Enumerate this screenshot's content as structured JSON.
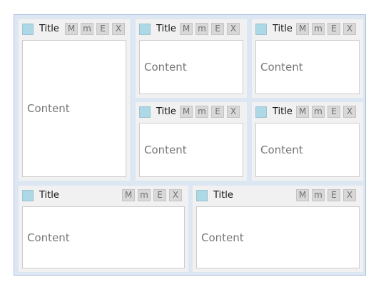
{
  "panels": [
    {
      "title": "Title",
      "buttons": [
        "M",
        "m",
        "E",
        "X"
      ],
      "content": "Content"
    },
    {
      "title": "Title",
      "buttons": [
        "M",
        "m",
        "E",
        "X"
      ],
      "content": "Content"
    },
    {
      "title": "Title",
      "buttons": [
        "M",
        "m",
        "E",
        "X"
      ],
      "content": "Content"
    },
    {
      "title": "Title",
      "buttons": [
        "M",
        "m",
        "E",
        "X"
      ],
      "content": "Content"
    },
    {
      "title": "Title",
      "buttons": [
        "M",
        "m",
        "E",
        "X"
      ],
      "content": "Content"
    },
    {
      "title": "Title",
      "buttons": [
        "M",
        "m",
        "E",
        "X"
      ],
      "content": "Content"
    },
    {
      "title": "Title",
      "buttons": [
        "M",
        "m",
        "E",
        "X"
      ],
      "content": "Content"
    }
  ],
  "colors": {
    "container_background": "#dde7f3",
    "container_border": "#a9c0dd",
    "panel_background": "#f1f1f1",
    "swatch": "#add8e6",
    "button_background": "#d8d8d8"
  }
}
